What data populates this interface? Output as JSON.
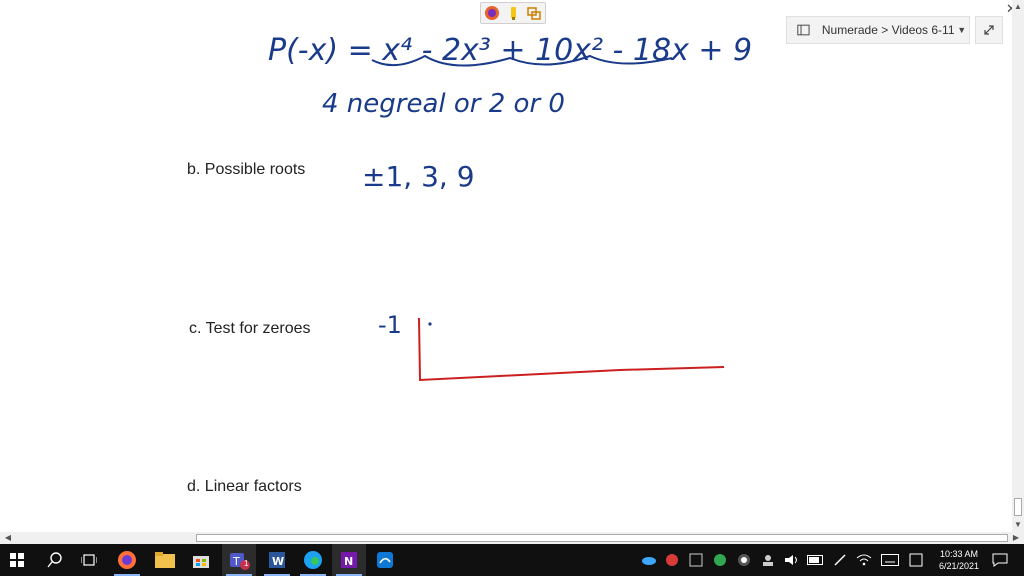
{
  "notebook": {
    "breadcrumb": "Numerade > Videos 6-11"
  },
  "handwriting": {
    "equation": "P(-x) = x⁴ - 2x³ + 10x² - 18x + 9",
    "note": "4 negreal or 2 or 0",
    "roots": "±1, 3, 9",
    "test_value": "-1"
  },
  "labels": {
    "possible_roots": "b.  Possible roots",
    "test_zeroes": "c.  Test for zeroes",
    "linear_factors": "d.  Linear factors"
  },
  "taskbar": {
    "time": "10:33 AM",
    "date": "6/21/2021",
    "teams_badge": "1"
  },
  "colors": {
    "ink": "#1a3a8a",
    "red_ink": "#cc1f1f",
    "taskbar": "#101010"
  }
}
